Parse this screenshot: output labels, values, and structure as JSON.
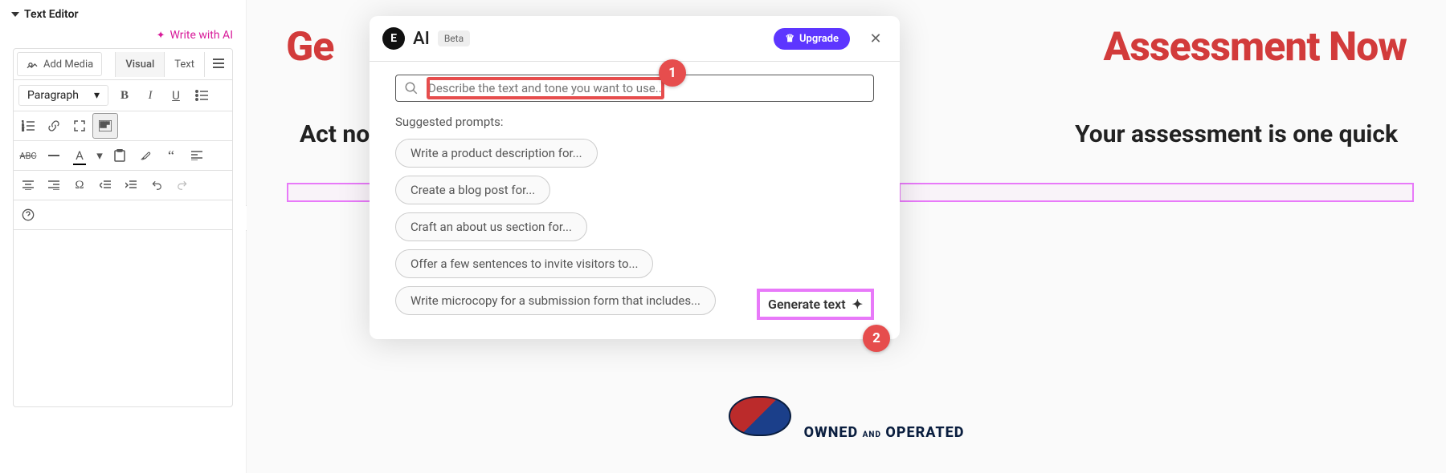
{
  "panel": {
    "title": "Text Editor",
    "writeWithAI": "Write with AI",
    "addMedia": "Add Media",
    "tabs": {
      "visual": "Visual",
      "text": "Text"
    },
    "paragraph": "Paragraph"
  },
  "canvas": {
    "heroLeft": "Ge",
    "heroRight": "Assessment Now",
    "subLeft": "Act now",
    "subRight": "Your assessment is one quick",
    "badgeLine": "OWNED AND OPERATED"
  },
  "modal": {
    "aiLabel": "AI",
    "beta": "Beta",
    "upgrade": "Upgrade",
    "searchPlaceholder": "Describe the text and tone you want to use...",
    "suggestedTitle": "Suggested prompts:",
    "prompts": [
      "Write a product description for...",
      "Create a blog post for...",
      "Craft an about us section for...",
      "Offer a few sentences to invite visitors to...",
      "Write microcopy for a submission form that includes..."
    ],
    "generate": "Generate text"
  },
  "callouts": {
    "c1": "1",
    "c2": "2"
  }
}
